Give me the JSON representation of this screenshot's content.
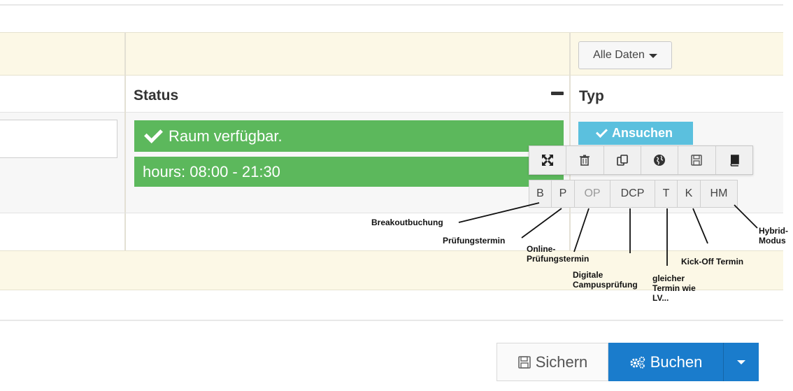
{
  "filter": {
    "dropdown_label": "Alle Daten"
  },
  "columns": {
    "status": "Status",
    "type": "Typ"
  },
  "status": {
    "available": "Raum verfügbar.",
    "hours": "hours: 08:00 - 21:30"
  },
  "type_button": "Ansuchen",
  "toolbar": {
    "icons": [
      "expand-icon",
      "trash-icon",
      "copy-icon",
      "globe-icon",
      "save-icon",
      "book-icon"
    ],
    "codes": [
      "B",
      "P",
      "OP",
      "DCP",
      "T",
      "K",
      "HM"
    ]
  },
  "annotations": {
    "breakout": "Breakoutbuchung",
    "pruefung": "Prüfungstermin",
    "online_1": "Online-",
    "online_2": "Prüfungstermin",
    "digital_1": "Digitale",
    "digital_2": "Campusprüfung",
    "gleich_1": "gleicher",
    "gleich_2": "Termin wie",
    "gleich_3": "LV...",
    "kickoff": "Kick-Off Termin",
    "hybrid_1": "Hybrid-",
    "hybrid_2": "Modus"
  },
  "footer": {
    "save_label": "Sichern",
    "book_label": "Buchen"
  },
  "colors": {
    "success": "#5cb85c",
    "info": "#5bc0de",
    "primary": "#1a7ccc",
    "cream": "#fcf8e6"
  }
}
